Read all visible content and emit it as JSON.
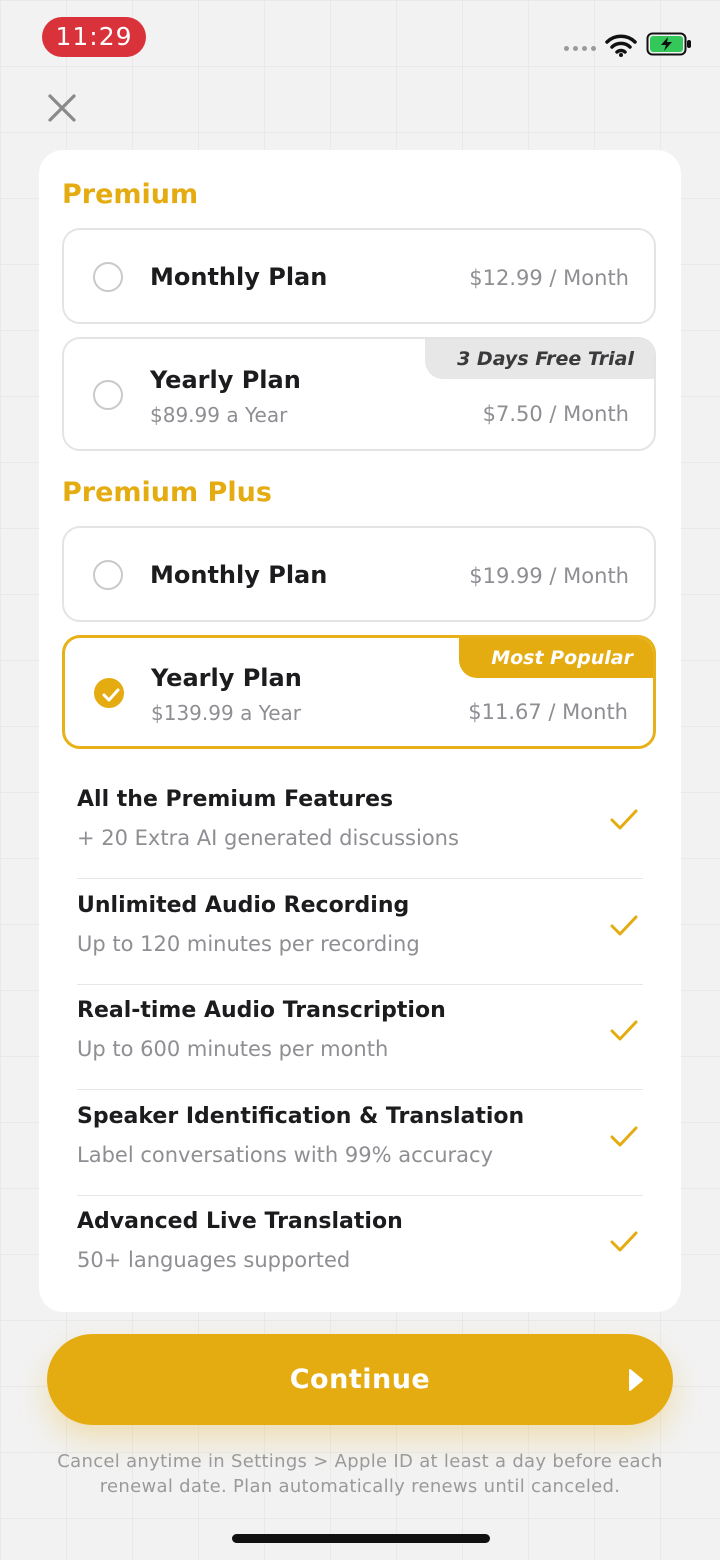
{
  "status_bar": {
    "time": "11:29"
  },
  "sections": [
    {
      "title": "Premium",
      "plans": [
        {
          "name": "Monthly Plan",
          "price": "$12.99 / Month",
          "selected": false
        },
        {
          "name": "Yearly Plan",
          "subtitle": "$89.99 a Year",
          "price": "$7.50 / Month",
          "badge": "3 Days Free Trial",
          "selected": false
        }
      ]
    },
    {
      "title": "Premium Plus",
      "plans": [
        {
          "name": "Monthly Plan",
          "price": "$19.99 / Month",
          "selected": false
        },
        {
          "name": "Yearly Plan",
          "subtitle": "$139.99 a Year",
          "price": "$11.67 / Month",
          "badge": "Most Popular",
          "selected": true
        }
      ]
    }
  ],
  "features": [
    {
      "title": "All the Premium Features",
      "subtitle": "+ 20 Extra AI generated discussions"
    },
    {
      "title": "Unlimited Audio Recording",
      "subtitle": "Up to 120 minutes per recording"
    },
    {
      "title": "Real-time Audio Transcription",
      "subtitle": "Up to 600 minutes per month"
    },
    {
      "title": "Speaker Identification & Translation",
      "subtitle": "Label conversations with 99% accuracy"
    },
    {
      "title": "Advanced Live Translation",
      "subtitle": "50+ languages supported"
    }
  ],
  "cta": {
    "label": "Continue"
  },
  "disclaimer": {
    "line1": "Cancel anytime in Settings > Apple ID at least a day before each",
    "line2": "renewal date. Plan automatically renews until canceled."
  },
  "colors": {
    "accent": "#e5ac12",
    "time_pill": "#d9323a",
    "battery": "#34c759"
  },
  "icons": {
    "close": "close-icon",
    "check": "checkmark-icon",
    "cta": "play-arrow-icon"
  }
}
